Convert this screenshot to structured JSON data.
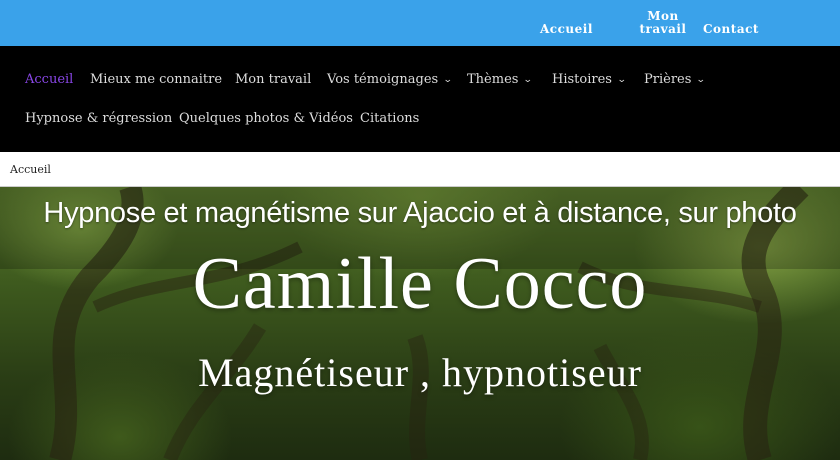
{
  "topbar": {
    "links": [
      "Accueil",
      "Mon travail",
      "Contact"
    ]
  },
  "mainnav": {
    "items": [
      {
        "label": "Accueil",
        "active": true
      },
      {
        "label": "Mieux me connaitre"
      },
      {
        "label": "Mon travail"
      },
      {
        "label": "Vos témoignages",
        "dropdown": true
      },
      {
        "label": "Thèmes",
        "dropdown": true
      },
      {
        "label": "Histoires",
        "dropdown": true
      },
      {
        "label": "Prières",
        "dropdown": true
      },
      {
        "label": "Hypnose & régression"
      },
      {
        "label": "Quelques photos & Vidéos"
      },
      {
        "label": "Citations"
      }
    ]
  },
  "breadcrumb": {
    "label": "Accueil"
  },
  "hero": {
    "title": "Hypnose et magnétisme sur Ajaccio et à distance, sur photo",
    "name": "Camille Cocco",
    "subtitle": "Magnétiseur , hypnotiseur"
  },
  "colors": {
    "topbar": "#3aa2ea",
    "nav_bg": "#000000",
    "active": "#8a47e8"
  }
}
